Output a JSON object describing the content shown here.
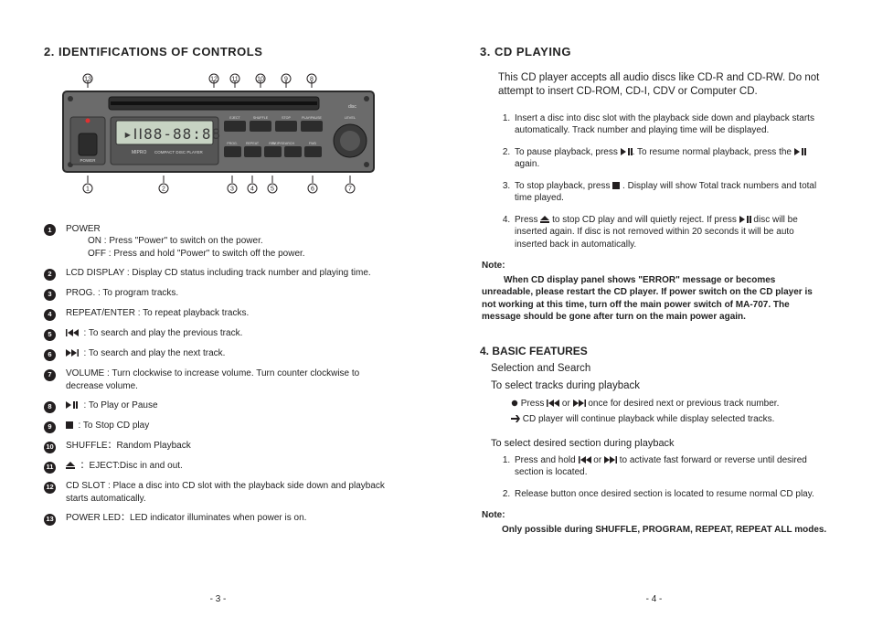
{
  "left": {
    "heading": "2. IDENTIFICATIONS OF CONTROLS",
    "pageNum": "- 3 -",
    "diagram": {
      "brand": "MIPRO",
      "label": "COMPACT DISC PLAYER",
      "lcd": "88-88:88",
      "buttons": {
        "power": "POWER",
        "eject": "EJECT",
        "shuffle": "SHUFFLE",
        "stop": "STOP",
        "play": "PLAY/PAUSE",
        "prog": "PROG.",
        "repeat": "REPEAT",
        "rev": "REV",
        "skip": "SKIP/SEARCH",
        "fwd": "FWD",
        "level": "LEVEL"
      }
    },
    "items": [
      {
        "n": "1",
        "title": "POWER",
        "lines": [
          "ON  : Press \"Power\" to switch on the power.",
          "OFF : Press and hold \"Power\" to switch off the power."
        ]
      },
      {
        "n": "2",
        "title": "",
        "lines": [
          "LCD DISPLAY : Display CD status including track number and playing time."
        ]
      },
      {
        "n": "3",
        "title": "",
        "lines": [
          "PROG. : To program tracks."
        ]
      },
      {
        "n": "4",
        "title": "",
        "lines": [
          "REPEAT/ENTER : To repeat playback tracks."
        ]
      },
      {
        "n": "5",
        "icon": "prev",
        "title": "",
        "lines": [
          ": To search and play the previous track."
        ]
      },
      {
        "n": "6",
        "icon": "next",
        "title": "",
        "lines": [
          ": To search and play the next track."
        ]
      },
      {
        "n": "7",
        "title": "",
        "lines": [
          "VOLUME : Turn clockwise to increase volume. Turn counter clockwise  to decrease volume."
        ]
      },
      {
        "n": "8",
        "icon": "playpause",
        "title": "",
        "lines": [
          ": To Play or Pause"
        ]
      },
      {
        "n": "9",
        "icon": "stop",
        "title": "",
        "lines": [
          ": To Stop CD play"
        ]
      },
      {
        "n": "10",
        "title": "",
        "lines": [
          "SHUFFLE：Random Playback"
        ]
      },
      {
        "n": "11",
        "icon": "eject",
        "title": "",
        "lines": [
          "：EJECT:Disc in and out."
        ]
      },
      {
        "n": "12",
        "title": "",
        "lines": [
          "CD SLOT : Place a disc into CD slot with the playback side down and playback starts automatically."
        ]
      },
      {
        "n": "13",
        "title": "",
        "lines": [
          "POWER LED：LED indicator illuminates when power is on."
        ]
      }
    ]
  },
  "right": {
    "heading3": "3. CD PLAYING",
    "intro3": "This CD player accepts all audio discs like CD-R and CD-RW. Do not attempt to insert CD-ROM, CD-I, CDV or Computer CD.",
    "steps3": [
      "Insert a disc into disc slot with the playback side down and playback starts automatically. Track number and playing time will be displayed.",
      "To pause playback, press [playpause]. To resume normal playback, press the [playpause] again.",
      "To stop playback, press [stop] .  Display will show Total track numbers and total time played.",
      "Press [eject] to stop CD play and will quietly reject.    If press [playpause] disc will be inserted again. If disc is not removed within 20 seconds it will be auto inserted back in automatically."
    ],
    "note3Label": "Note:",
    "note3": "When CD display panel shows \"ERROR\" message or becomes unreadable, please restart the CD player.  If power switch on the CD player is not working at this time, turn off the main power switch of MA-707.  The message should be gone after turn on the main power again.",
    "heading4": "4. BASIC FEATURES",
    "sub41": "Selection and Search",
    "sub42": "To select tracks during playback",
    "bullets4": [
      "Press [prev] or [next] once for desired next or previous track number.",
      "CD player will continue playback while display selected tracks."
    ],
    "sub43": "To select desired section during playback",
    "steps4": [
      "Press and hold [prev] or [next] to activate fast forward or reverse until desired section is located.",
      "Release button once desired section is located to resume normal CD play."
    ],
    "note4Label": "Note:",
    "note4": "Only possible during SHUFFLE, PROGRAM, REPEAT, REPEAT ALL modes.",
    "pageNum": "- 4 -"
  }
}
